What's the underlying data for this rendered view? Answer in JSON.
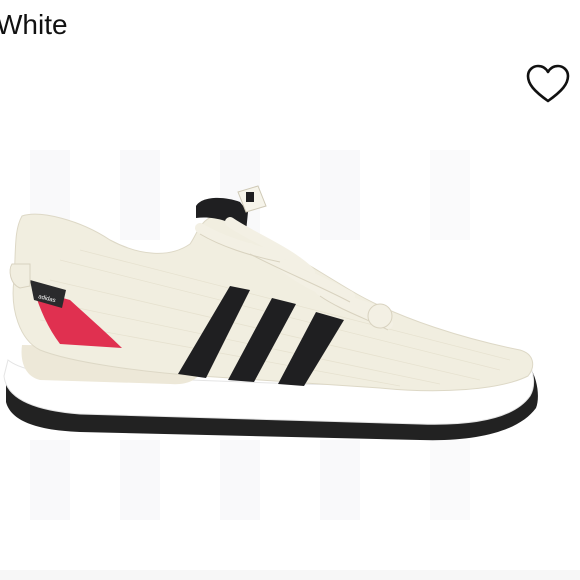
{
  "product": {
    "title": "White"
  },
  "favorite": {
    "icon": "heart-outline-icon"
  },
  "image": {
    "subject": "sneaker",
    "brand_text": "adidas",
    "colors": {
      "upper": "#f1eee0",
      "stripes": "#1f1f21",
      "heel_accent": "#e03050",
      "sole": "#ffffff",
      "outsole": "#222222"
    }
  }
}
